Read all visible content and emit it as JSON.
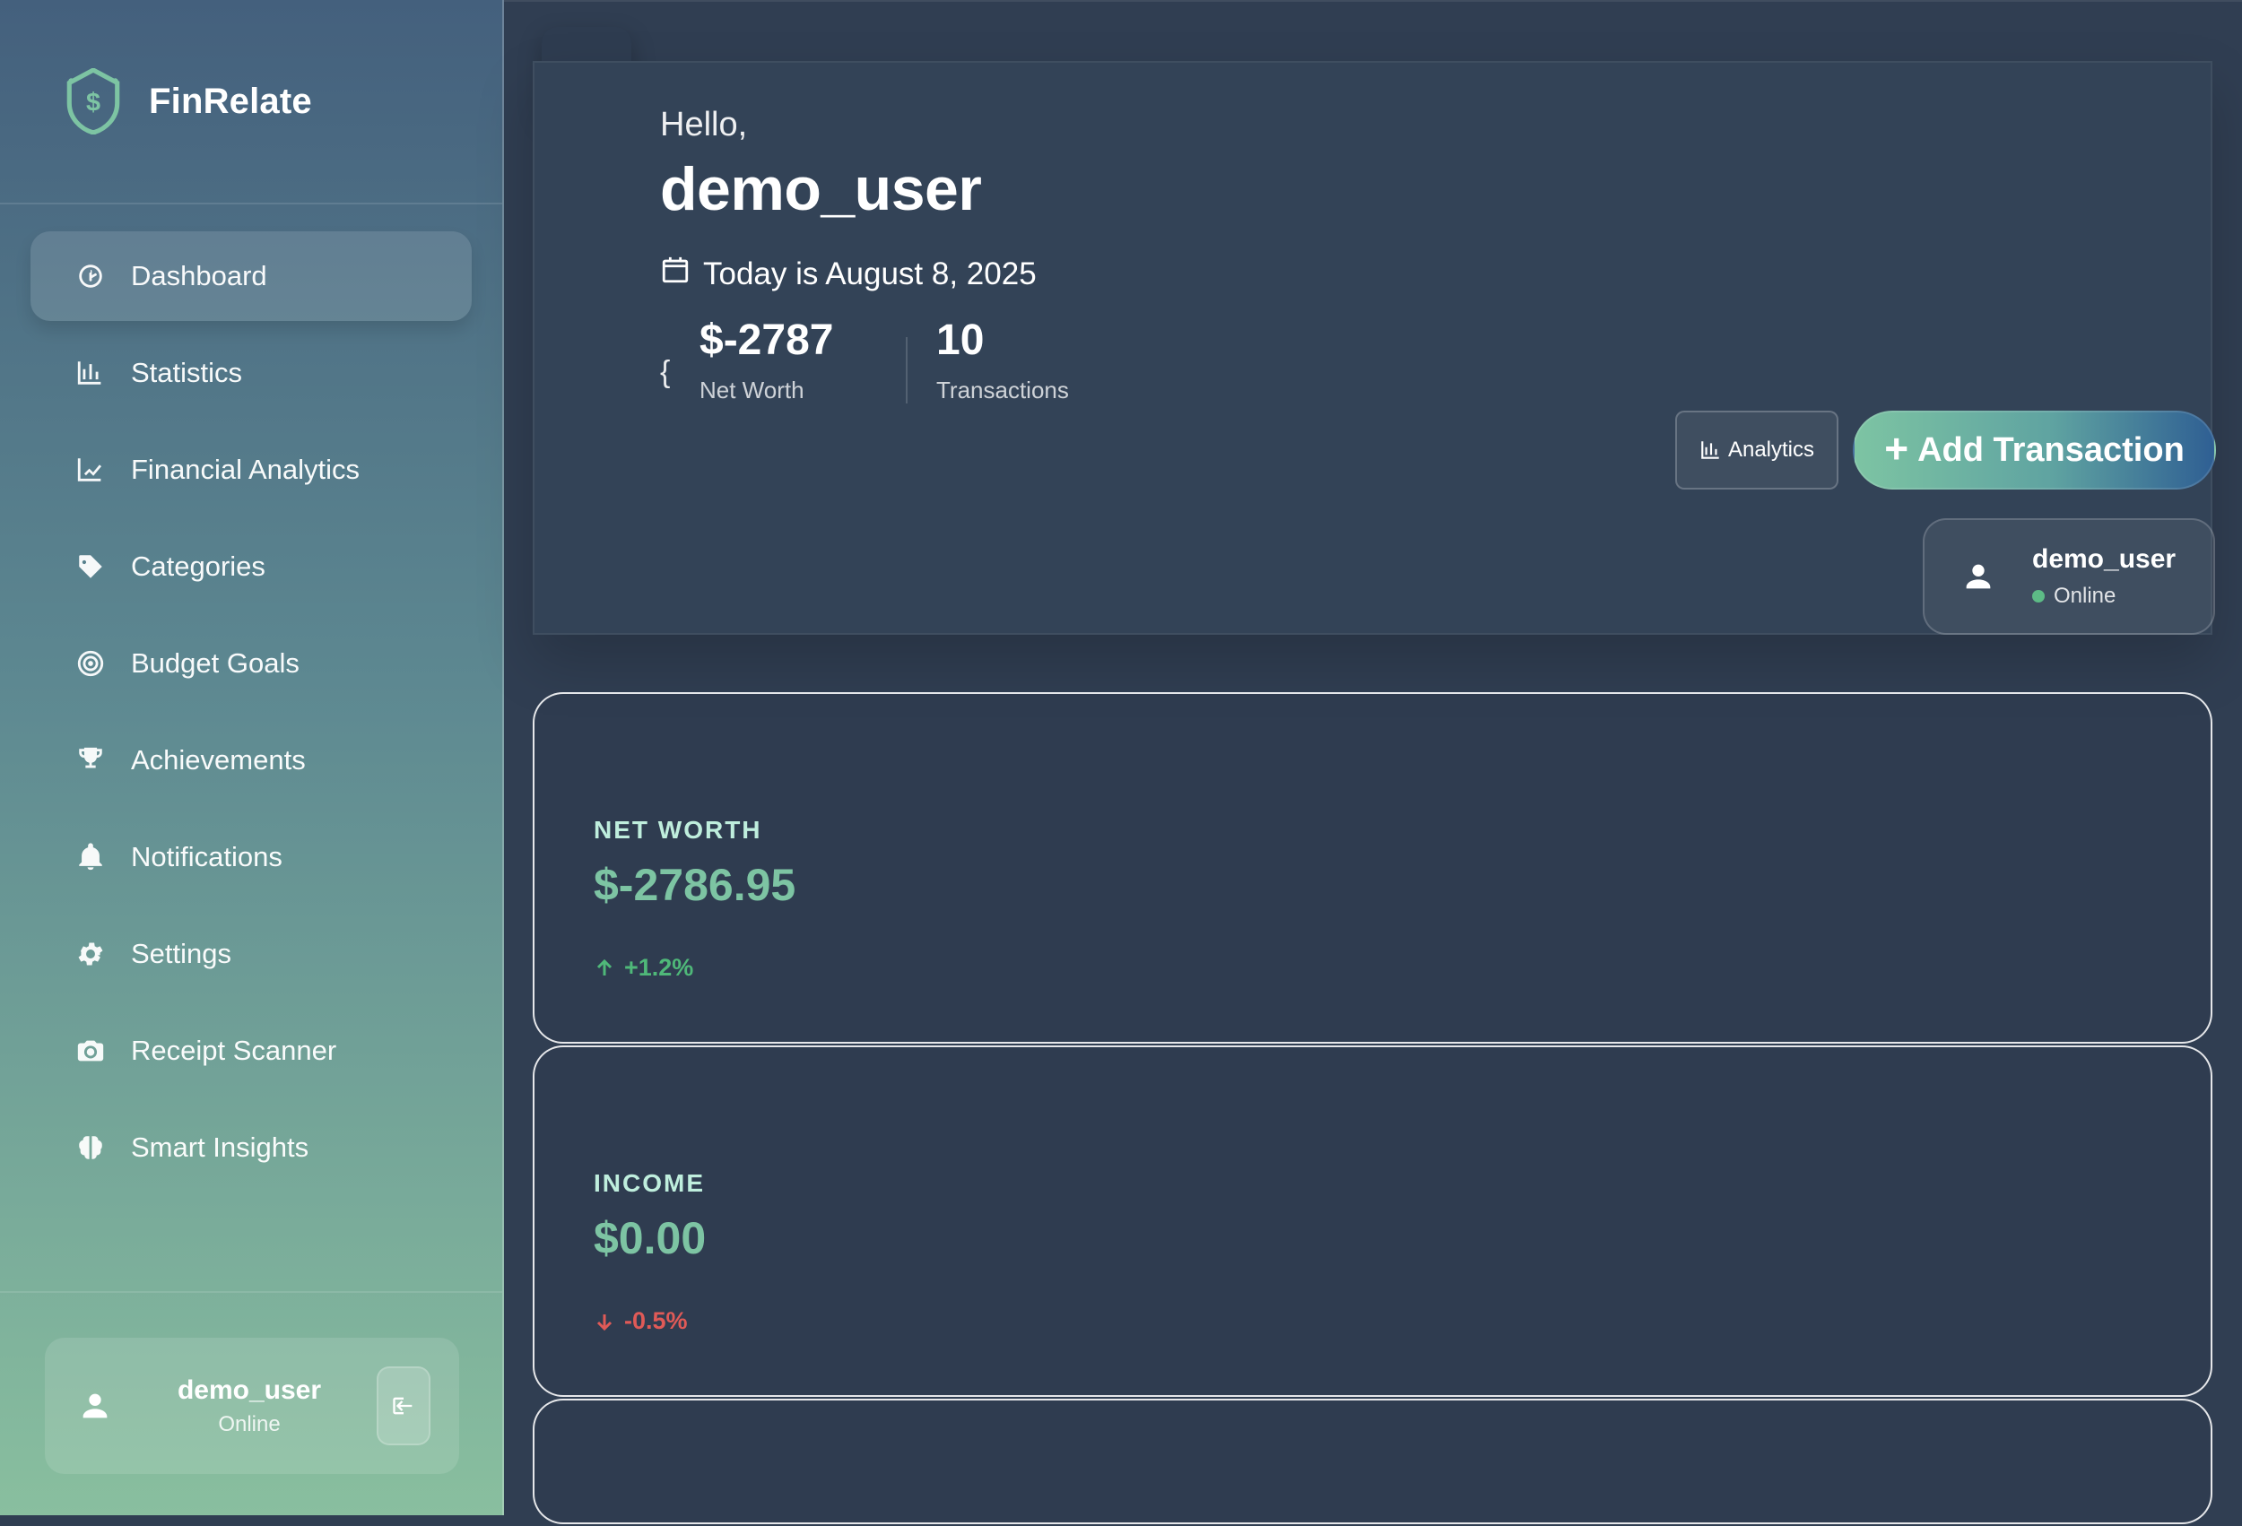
{
  "sidebar": {
    "brand": {
      "title": "FinRelate",
      "logo_icon": "shield-dollar-icon"
    },
    "items": [
      {
        "label": "Dashboard",
        "icon": "speedometer-icon",
        "active": true
      },
      {
        "label": "Statistics",
        "icon": "bar-chart-icon",
        "active": false
      },
      {
        "label": "Financial Analytics",
        "icon": "line-chart-icon",
        "active": false
      },
      {
        "label": "Categories",
        "icon": "tags-icon",
        "active": false
      },
      {
        "label": "Budget Goals",
        "icon": "target-icon",
        "active": false
      },
      {
        "label": "Achievements",
        "icon": "trophy-icon",
        "active": false
      },
      {
        "label": "Notifications",
        "icon": "bell-icon",
        "active": false
      },
      {
        "label": "Settings",
        "icon": "gear-icon",
        "active": false
      },
      {
        "label": "Receipt Scanner",
        "icon": "camera-icon",
        "active": false
      },
      {
        "label": "Smart Insights",
        "icon": "brain-icon",
        "active": false
      }
    ],
    "user": {
      "name": "demo_user",
      "status": "Online"
    }
  },
  "header": {
    "hello": "Hello,",
    "username": "demo_user",
    "date_text": "Today is August 8, 2025",
    "brace": "{",
    "stats": [
      {
        "value": "$-2787",
        "label": "Net Worth"
      },
      {
        "value": "10",
        "label": "Transactions"
      }
    ],
    "buttons": {
      "analytics": "Analytics",
      "add_transaction": "Add Transaction"
    },
    "user": {
      "name": "demo_user",
      "status": "Online"
    }
  },
  "cards": [
    {
      "label": "NET WORTH",
      "value": "$-2786.95",
      "change": "+1.2%",
      "direction": "up"
    },
    {
      "label": "INCOME",
      "value": "$0.00",
      "change": "-0.5%",
      "direction": "down"
    }
  ],
  "colors": {
    "accent": "#7dc4a3",
    "up": "#4fb879",
    "down": "#e05a57"
  }
}
